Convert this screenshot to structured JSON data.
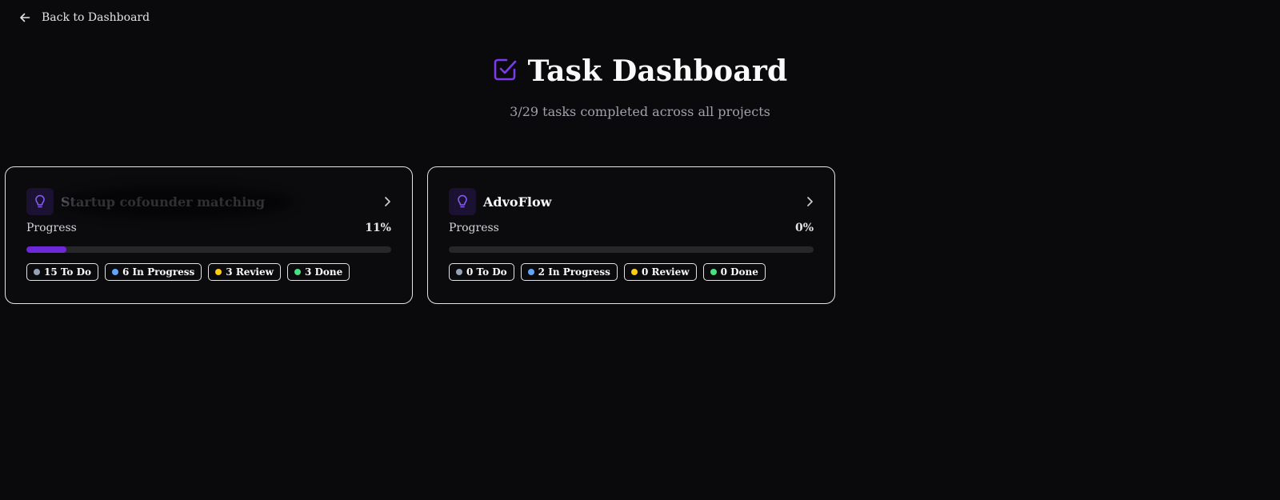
{
  "nav": {
    "back_label": "Back to Dashboard",
    "back_icon": "arrow-left-icon"
  },
  "header": {
    "title": "Task Dashboard",
    "title_icon": "checkbox-icon",
    "subtitle": "3/29 tasks completed across all projects"
  },
  "colors": {
    "accent": "#7c3aed",
    "todo": "#94a3b8",
    "in_progress": "#60a5fa",
    "review": "#facc15",
    "done": "#4ade80"
  },
  "projects": [
    {
      "name": "Startup cofounder matching",
      "icon": "lightbulb-icon",
      "progress_label": "Progress",
      "progress_pct": "11%",
      "progress_value": 11,
      "badges": {
        "todo": "15 To Do",
        "in_progress": "6 In Progress",
        "review": "3 Review",
        "done": "3 Done"
      }
    },
    {
      "name": "AdvoFlow",
      "icon": "lightbulb-icon",
      "progress_label": "Progress",
      "progress_pct": "0%",
      "progress_value": 0,
      "badges": {
        "todo": "0 To Do",
        "in_progress": "2 In Progress",
        "review": "0 Review",
        "done": "0 Done"
      }
    }
  ]
}
